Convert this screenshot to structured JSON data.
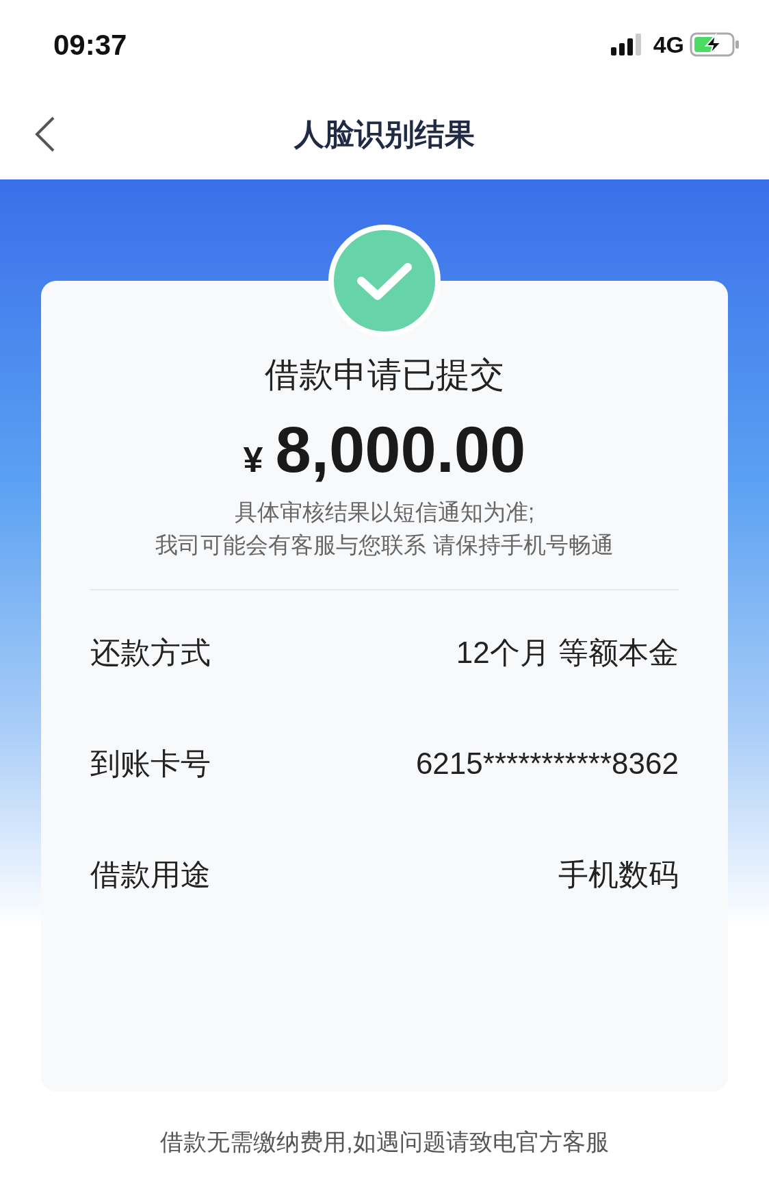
{
  "status_bar": {
    "time": "09:37",
    "network": "4G"
  },
  "nav": {
    "title": "人脸识别结果"
  },
  "result": {
    "headline": "借款申请已提交",
    "currency": "¥",
    "amount": "8,000.00",
    "notes": [
      "具体审核结果以短信通知为准;",
      "我司可能会有客服与您联系 请保持手机号畅通"
    ]
  },
  "details": [
    {
      "label": "还款方式",
      "value": "12个月 等额本金"
    },
    {
      "label": "到账卡号",
      "value": "6215***********8362"
    },
    {
      "label": "借款用途",
      "value": "手机数码"
    }
  ],
  "footer": "借款无需缴纳费用,如遇问题请致电官方客服"
}
